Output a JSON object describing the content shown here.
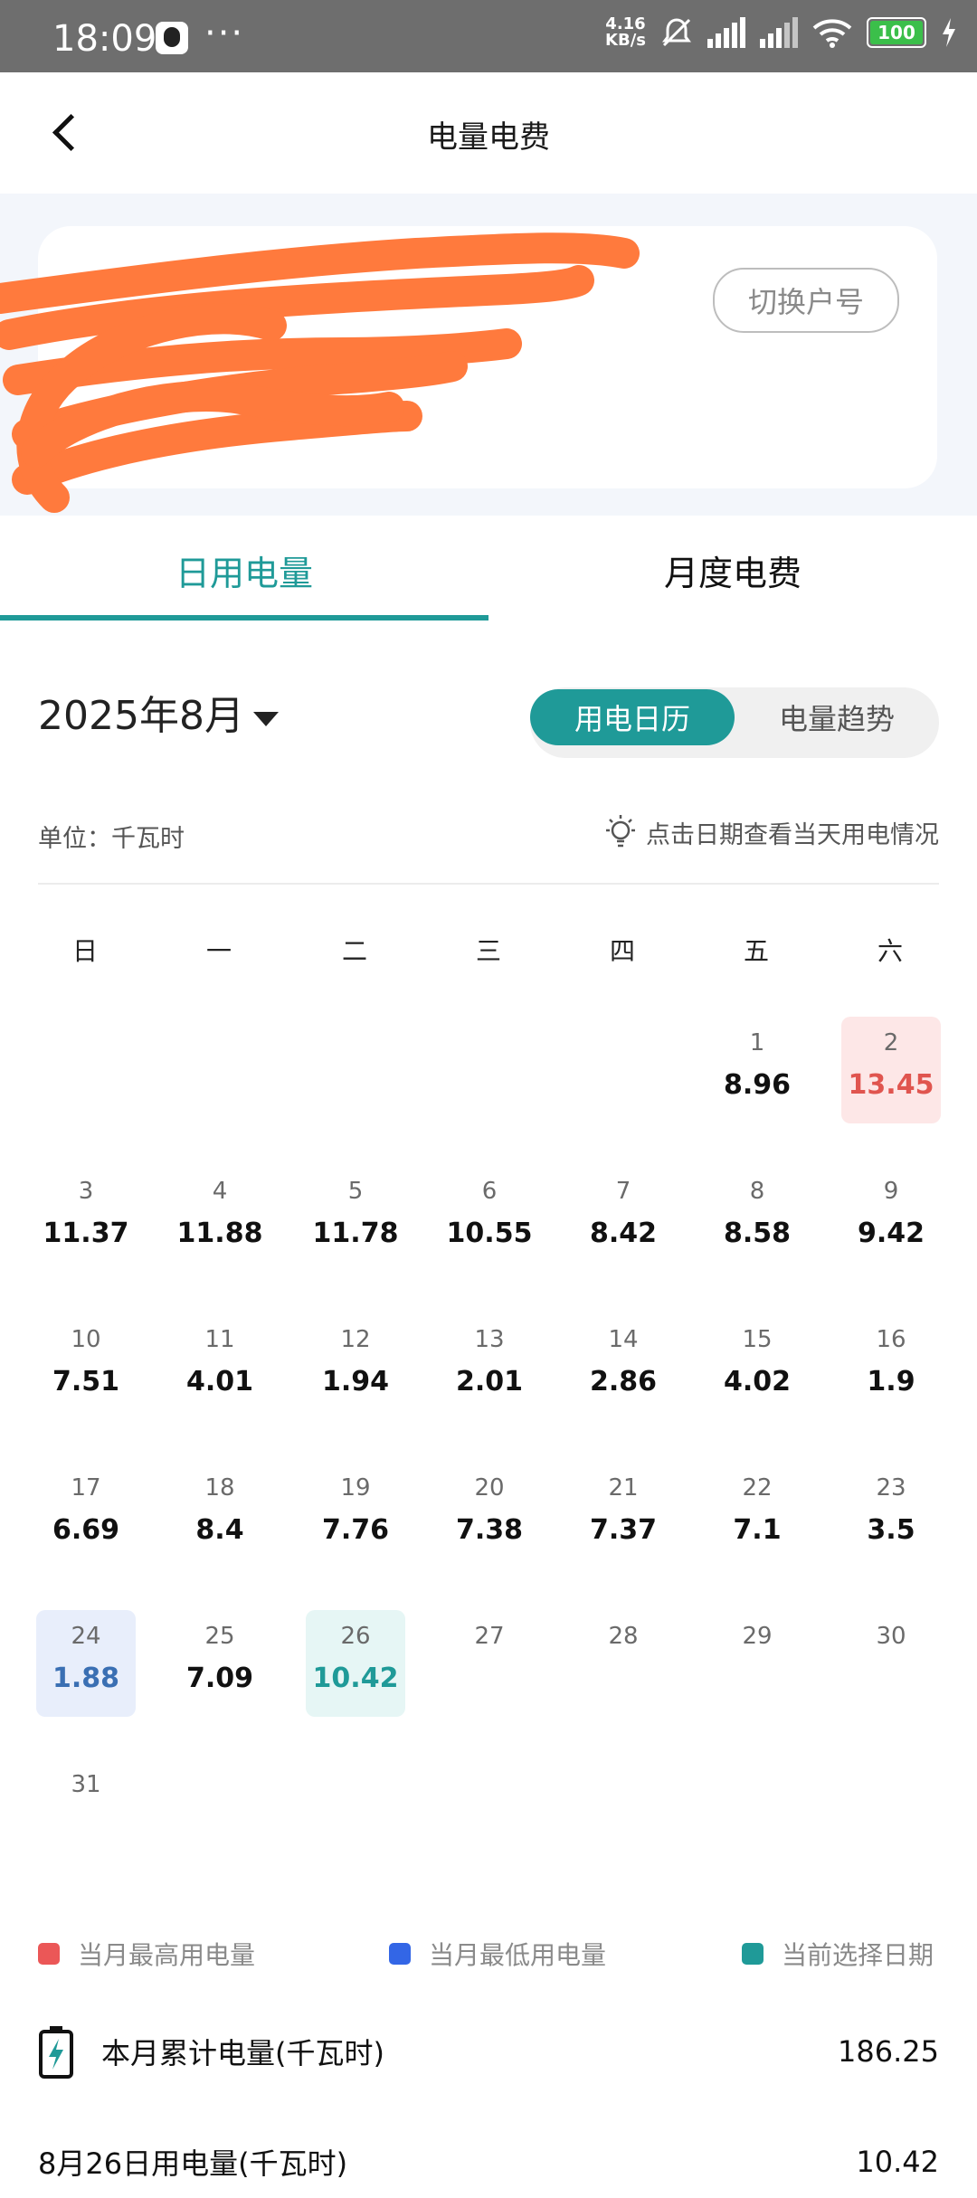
{
  "status_bar": {
    "time": "18:09",
    "dots": "···",
    "speed_top": "4.16",
    "speed_bottom": "KB/s",
    "battery": "100",
    "icons": [
      "qq-icon",
      "bell-off-icon",
      "hd-signal-icon",
      "hd-signal-icon",
      "wifi-icon",
      "battery-icon",
      "charging-icon"
    ]
  },
  "header": {
    "title": "电量电费"
  },
  "account": {
    "switch_label": "切换户号"
  },
  "tabs": [
    {
      "label": "日用电量",
      "active": true
    },
    {
      "label": "月度电费",
      "active": false
    }
  ],
  "calendar_header": {
    "month": "2025年8月",
    "segment": [
      "用电日历",
      "电量趋势"
    ],
    "unit": "单位：千瓦时",
    "hint": "点击日期查看当天用电情况"
  },
  "weekdays": [
    "日",
    "一",
    "二",
    "三",
    "四",
    "五",
    "六"
  ],
  "days": [
    {
      "day": "1",
      "value": "8.96",
      "state": ""
    },
    {
      "day": "2",
      "value": "13.45",
      "state": "high"
    },
    {
      "day": "3",
      "value": "11.37",
      "state": ""
    },
    {
      "day": "4",
      "value": "11.88",
      "state": ""
    },
    {
      "day": "5",
      "value": "11.78",
      "state": ""
    },
    {
      "day": "6",
      "value": "10.55",
      "state": ""
    },
    {
      "day": "7",
      "value": "8.42",
      "state": ""
    },
    {
      "day": "8",
      "value": "8.58",
      "state": ""
    },
    {
      "day": "9",
      "value": "9.42",
      "state": ""
    },
    {
      "day": "10",
      "value": "7.51",
      "state": ""
    },
    {
      "day": "11",
      "value": "4.01",
      "state": ""
    },
    {
      "day": "12",
      "value": "1.94",
      "state": ""
    },
    {
      "day": "13",
      "value": "2.01",
      "state": ""
    },
    {
      "day": "14",
      "value": "2.86",
      "state": ""
    },
    {
      "day": "15",
      "value": "4.02",
      "state": ""
    },
    {
      "day": "16",
      "value": "1.9",
      "state": ""
    },
    {
      "day": "17",
      "value": "6.69",
      "state": ""
    },
    {
      "day": "18",
      "value": "8.4",
      "state": ""
    },
    {
      "day": "19",
      "value": "7.76",
      "state": ""
    },
    {
      "day": "20",
      "value": "7.38",
      "state": ""
    },
    {
      "day": "21",
      "value": "7.37",
      "state": ""
    },
    {
      "day": "22",
      "value": "7.1",
      "state": ""
    },
    {
      "day": "23",
      "value": "3.5",
      "state": ""
    },
    {
      "day": "24",
      "value": "1.88",
      "state": "low"
    },
    {
      "day": "25",
      "value": "7.09",
      "state": ""
    },
    {
      "day": "26",
      "value": "10.42",
      "state": "sel"
    },
    {
      "day": "27",
      "value": "",
      "state": ""
    },
    {
      "day": "28",
      "value": "",
      "state": ""
    },
    {
      "day": "29",
      "value": "",
      "state": ""
    },
    {
      "day": "30",
      "value": "",
      "state": ""
    },
    {
      "day": "31",
      "value": "",
      "state": ""
    }
  ],
  "first_weekday_index": 5,
  "legend": [
    {
      "label": "当月最高用电量",
      "color": "#eb5757"
    },
    {
      "label": "当月最低用电量",
      "color": "#3366e6"
    },
    {
      "label": "当前选择日期",
      "color": "#1f9a98"
    }
  ],
  "summary": {
    "monthly_label": "本月累计电量(千瓦时)",
    "monthly_value": "186.25",
    "day_label": "8月26日用电量(千瓦时)",
    "day_value": "10.42"
  },
  "colors": {
    "accent": "#1f9a98",
    "high": "#e0554f",
    "low": "#3a6fb3",
    "redaction": "#ff7a3d"
  }
}
